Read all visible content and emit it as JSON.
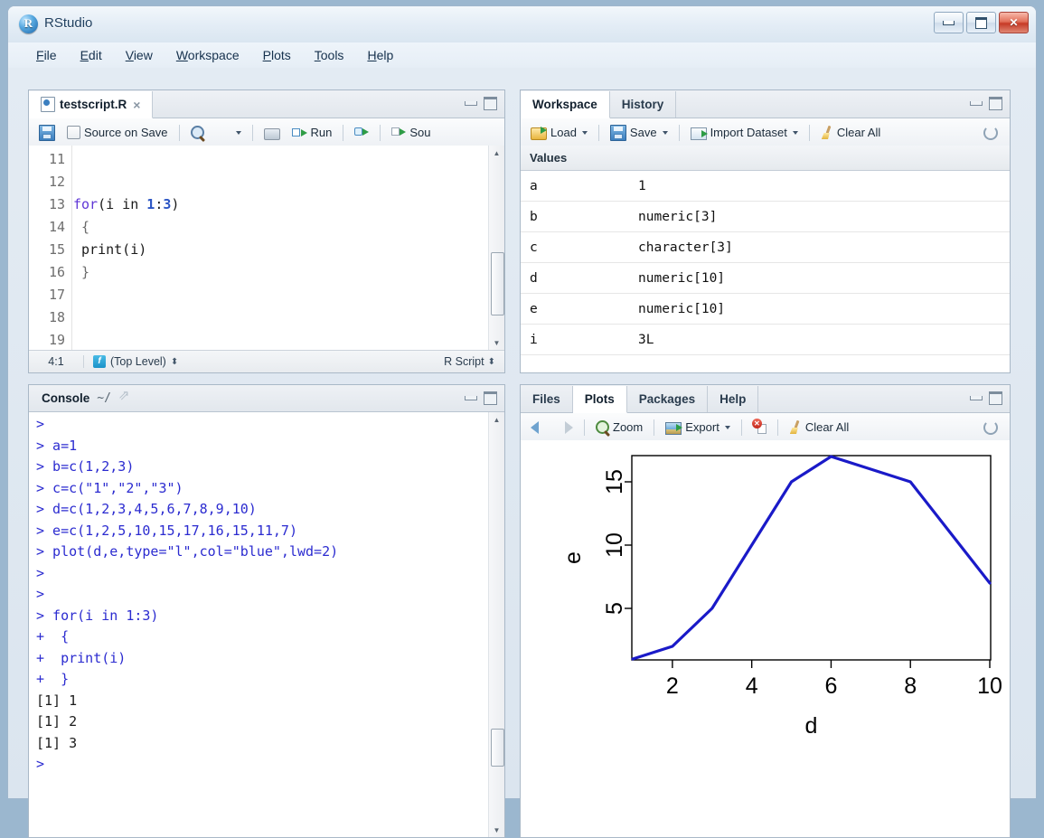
{
  "window": {
    "title": "RStudio",
    "logo_icon": "rstudio-logo",
    "controls": [
      {
        "name": "minimize-button",
        "icon": "minimize-icon"
      },
      {
        "name": "maximize-button",
        "icon": "maximize-icon"
      },
      {
        "name": "close-button",
        "icon": "close-icon",
        "glyph": "✕"
      }
    ]
  },
  "menubar": {
    "items": [
      {
        "label": "File",
        "mnemonic": "F"
      },
      {
        "label": "Edit",
        "mnemonic": "E"
      },
      {
        "label": "View",
        "mnemonic": "V"
      },
      {
        "label": "Workspace",
        "mnemonic": "W"
      },
      {
        "label": "Plots",
        "mnemonic": "P"
      },
      {
        "label": "Tools",
        "mnemonic": "T"
      },
      {
        "label": "Help",
        "mnemonic": "H"
      }
    ]
  },
  "editor": {
    "tab_label": "testscript.R",
    "tab_icon": "r-script-file-icon",
    "tab_close_glyph": "×",
    "toolbar": {
      "save_label": "",
      "source_on_save_label": "Source on Save",
      "find_icon": "search-icon",
      "wand_icon": "code-tools-wand-icon",
      "print_icon": "print-icon",
      "run_label": "Run",
      "rerun_icon": "rerun-icon",
      "source_label": "Sou"
    },
    "lines": [
      {
        "number": "11",
        "text": ""
      },
      {
        "number": "12",
        "text": ""
      },
      {
        "number": "13",
        "text": "for(i in 1:3)"
      },
      {
        "number": "14",
        "text": " {"
      },
      {
        "number": "15",
        "text": " print(i)"
      },
      {
        "number": "16",
        "text": " }"
      },
      {
        "number": "17",
        "text": ""
      },
      {
        "number": "18",
        "text": ""
      },
      {
        "number": "19",
        "text": ""
      }
    ],
    "status": {
      "position": "4:1",
      "scope": "(Top Level)",
      "scope_icon": "function-scope-icon",
      "file_type": "R Script"
    }
  },
  "workspace": {
    "tabs": [
      {
        "label": "Workspace",
        "active": true
      },
      {
        "label": "History",
        "active": false
      }
    ],
    "toolbar": {
      "load_label": "Load",
      "save_label": "Save",
      "import_label": "Import Dataset",
      "clear_label": "Clear All",
      "refresh_icon": "refresh-icon"
    },
    "section_header": "Values",
    "rows": [
      {
        "name": "a",
        "value": "1"
      },
      {
        "name": "b",
        "value": "numeric[3]"
      },
      {
        "name": "c",
        "value": "character[3]"
      },
      {
        "name": "d",
        "value": "numeric[10]"
      },
      {
        "name": "e",
        "value": "numeric[10]"
      },
      {
        "name": "i",
        "value": "3L"
      }
    ]
  },
  "console": {
    "title": "Console",
    "path": "~/",
    "share_icon": "popout-icon",
    "lines": [
      {
        "text": ">",
        "kind": "input"
      },
      {
        "text": "> a=1",
        "kind": "input"
      },
      {
        "text": "> b=c(1,2,3)",
        "kind": "input"
      },
      {
        "text": "> c=c(\"1\",\"2\",\"3\")",
        "kind": "input"
      },
      {
        "text": "> d=c(1,2,3,4,5,6,7,8,9,10)",
        "kind": "input"
      },
      {
        "text": "> e=c(1,2,5,10,15,17,16,15,11,7)",
        "kind": "input"
      },
      {
        "text": "> plot(d,e,type=\"l\",col=\"blue\",lwd=2)",
        "kind": "input"
      },
      {
        "text": ">",
        "kind": "input"
      },
      {
        "text": ">",
        "kind": "input"
      },
      {
        "text": "> for(i in 1:3)",
        "kind": "input"
      },
      {
        "text": "+  {",
        "kind": "input"
      },
      {
        "text": "+  print(i)",
        "kind": "input"
      },
      {
        "text": "+  }",
        "kind": "input"
      },
      {
        "text": "[1] 1",
        "kind": "output"
      },
      {
        "text": "[1] 2",
        "kind": "output"
      },
      {
        "text": "[1] 3",
        "kind": "output"
      },
      {
        "text": ">",
        "kind": "input"
      }
    ]
  },
  "plots": {
    "tabs": [
      {
        "label": "Files",
        "active": false
      },
      {
        "label": "Plots",
        "active": true
      },
      {
        "label": "Packages",
        "active": false
      },
      {
        "label": "Help",
        "active": false
      }
    ],
    "toolbar": {
      "back_icon": "arrow-left-icon",
      "forward_icon": "arrow-right-icon",
      "zoom_label": "Zoom",
      "export_label": "Export",
      "remove_icon": "remove-plot-icon",
      "clear_label": "Clear All",
      "refresh_icon": "refresh-icon"
    }
  },
  "chart_data": {
    "type": "line",
    "title": "",
    "xlabel": "d",
    "ylabel": "e",
    "x": [
      1,
      2,
      3,
      4,
      5,
      6,
      7,
      8,
      9,
      10
    ],
    "values": [
      1,
      2,
      5,
      10,
      15,
      17,
      16,
      15,
      11,
      7
    ],
    "series": [
      {
        "name": "e",
        "values": [
          1,
          2,
          5,
          10,
          15,
          17,
          16,
          15,
          11,
          7
        ]
      }
    ],
    "xlim": [
      1,
      10
    ],
    "ylim": [
      1,
      17
    ],
    "xticks": [
      2,
      4,
      6,
      8,
      10
    ],
    "yticks": [
      5,
      10,
      15
    ],
    "line_color": "#1a1ac8",
    "line_width": 2,
    "grid": false,
    "legend": "none"
  }
}
